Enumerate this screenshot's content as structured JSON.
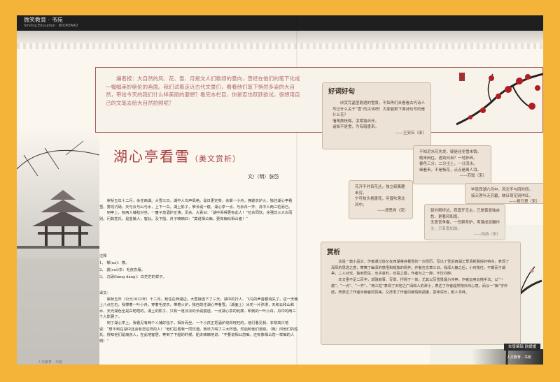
{
  "header": {
    "brand_cn": "微笑教育 · 书苑",
    "brand_en": "Smiling Education · BOOKYARD"
  },
  "intro": {
    "text": "编者按：大自然的风、花、雪、月是文人们歌颂的意向，曾经在他们的笔下化成一幅幅美妙绝伦的画面。我们试着走近古代文豪们，看看他们笔下悄然多姿的大自然，带给今天的我们什么样美丽的遐想？看完本栏目，你是否也跃跃欲试，很想用自己的文笔去给大自然拍照呢？"
  },
  "haoju": {
    "title": "好词好句",
    "lines": [
      "欣赏完晶莹剔透的雪景，不如再们去看看古代诗人写过什么关于“雪”的古诗吧！大家能默下面诗句写的是什么花？",
      "墙角数枝梅，凌寒独自开。",
      "遥知不是雪，为有暗香来。"
    ],
    "source": "——王安石（宋）"
  },
  "poems": [
    {
      "lines": [
        "不知近水花先发，疑是经冬雪未销。",
        "晚来闲往，遇到何自？一地拌碎。",
        "春色三分，二分尘土，一分流水。",
        "细看来，不是杨花，点点是离人泪。"
      ],
      "source": "——苏轼（宋）"
    },
    {
      "lines": [
        "花开不并百花丛，独立疏篱趣未穷。",
        "宁可枝头抱香死，何曾吹落北风中。"
      ],
      "source": "——郑思肖（宋）"
    },
    {
      "lines": [
        "毕竟西湖六月中，风光不与四时同。",
        "接天莲叶无穷碧，映日荷花别样红。"
      ],
      "source": "——杨万里（宋）"
    },
    {
      "lines": [
        "驿外断桥边，寂寞开无主。已是黄昏独自愁，更著风和雨。",
        "无意苦争春，一任群芳妒。零落成泥碾作尘，只有香如故。"
      ],
      "source": "——陆游（宋）"
    }
  ],
  "article": {
    "title": "湖心亭看雪",
    "subtitle": "（美文赏析）",
    "author": "文/（明）张岱",
    "paragraphs": [
      "崇祯五年十二月，余住西湖。大雪三日，湖中人鸟声俱绝。是日更定矣，余拏一小舟，拥毳衣炉火，独往湖心亭看雪。雾凇沆砀，天与云与山与水，上下一白。湖上影子，惟长堤一痕、湖心亭一点、与余舟一芥、舟中人两三粒而已。",
      "到亭上，有两人铺毡对坐，一童子烧酒炉正沸。见余，大喜曰：“湖中焉得更有此人！”拉余同饮。余强饮三大白而别。问其姓氏，是金陵人，客此。及下船，舟子喃喃曰：“莫说相公痴，更有痴似相公者！”"
    ],
    "notes_title": "注释",
    "notes": [
      "1、 拏(ná)：撑。",
      "2、 毳(cuì)衣：毛皮衣服。",
      "3、 沆砀(hàng dàng)：白茫茫的样子。"
    ],
    "translation_title": "译文：",
    "translation": [
      "崇祯五年（公元1632年）十二月，我住在西湖边。大雪接连下了三天，湖中的行人、飞鸟的声音都消失了。这一天晚上八点左右，我撑着一叶小舟，穿着毛皮衣，带着火炉，独自前往湖心亭看雪。（湖面上）冰花一片弥漫，天和云和山和水，天光湖色全是白皑皑的。湖上的影子，只有一道淡淡的长堤痕迹、一点湖心亭的轮廓，和我的一叶小舟，舟中的两三个人影罢了。",
      "到了湖心亭上，我看见有两个人铺好毡子，相对而坐，一个小孩正把酒炉烧得旺旺的。他们看见我，非常高兴地说：“想不到在湖中还会有您这样的人！”他们拉着我一同饮酒。我尽力喝了三大杯酒，然后和他们道别。（我）问他们的姓氏，得知他们是南京人，在此地客居。等到了下船的时候，船夫喃喃地说：“不要说相公您痴，还有像相公您一样痴的人啊！”"
    ]
  },
  "shangxi": {
    "title": "赏析",
    "paragraphs": [
      "这是一篇小品文，作者通过追忆在西湖乘舟看雪的一次经历，写出了雪后西湖之景清新脱俗的特点，表现了深厚的思念之意，寄寓了幽深的感悟和孤独的情怀。作者在文章三日，我深入静之后，小舟独往，不期而于湖亭，二人对饮，独到而生，出乎意料，欣喜之极，作者为之一醉，不饮亦醉。",
      "本文虽不足二百字，却融叙事、写景、抒情于一体，尤其以写雪景最为传神。作者运用白描手法，以“一痕”、“一点”、“一芥”、“两三粒”表现了天地之广阔和人的渺小，表达了作者超然物外的心境，而以一“痴”字作结，既表达了作者对痴者的赞美，又抒发了作者的痴情和孤傲，意味深长，耐人寻味。"
    ]
  },
  "footer": {
    "left": "人文教育 · 书苑",
    "editor_tag": "本版编辑 欧媛媛",
    "right": "人文教育 · 书苑"
  }
}
